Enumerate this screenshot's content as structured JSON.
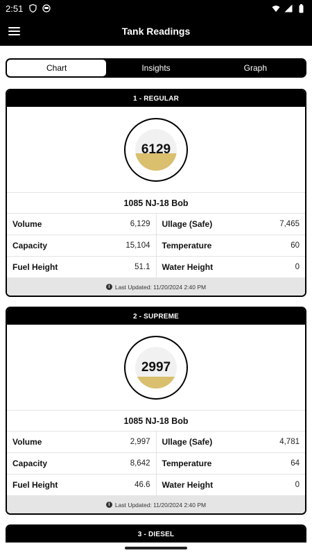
{
  "status_bar": {
    "time": "2:51"
  },
  "header": {
    "title": "Tank Readings"
  },
  "tabs": [
    {
      "label": "Chart",
      "active": true
    },
    {
      "label": "Insights",
      "active": false
    },
    {
      "label": "Graph",
      "active": false
    }
  ],
  "tanks": [
    {
      "title": "1 - REGULAR",
      "gauge_value": "6129",
      "fill_fraction": 0.41,
      "site": "1085 NJ-18 Bob",
      "rows": [
        {
          "l1": "Volume",
          "v1": "6,129",
          "l2": "Ullage (Safe)",
          "v2": "7,465"
        },
        {
          "l1": "Capacity",
          "v1": "15,104",
          "l2": "Temperature",
          "v2": "60"
        },
        {
          "l1": "Fuel Height",
          "v1": "51.1",
          "l2": "Water Height",
          "v2": "0"
        }
      ],
      "last_updated": "Last Updated: 11/20/2024 2:40 PM"
    },
    {
      "title": "2 - SUPREME",
      "gauge_value": "2997",
      "fill_fraction": 0.28,
      "site": "1085 NJ-18 Bob",
      "rows": [
        {
          "l1": "Volume",
          "v1": "2,997",
          "l2": "Ullage (Safe)",
          "v2": "4,781"
        },
        {
          "l1": "Capacity",
          "v1": "8,642",
          "l2": "Temperature",
          "v2": "64"
        },
        {
          "l1": "Fuel Height",
          "v1": "46.6",
          "l2": "Water Height",
          "v2": "0"
        }
      ],
      "last_updated": "Last Updated: 11/20/2024 2:40 PM"
    },
    {
      "title": "3 - DIESEL"
    }
  ],
  "colors": {
    "fuel_fill": "#d9bf6e",
    "header_bg": "#000000"
  },
  "icons": [
    "menu-icon",
    "info-icon",
    "wifi-icon",
    "signal-icon",
    "battery-icon",
    "shield-icon",
    "user-icon"
  ]
}
